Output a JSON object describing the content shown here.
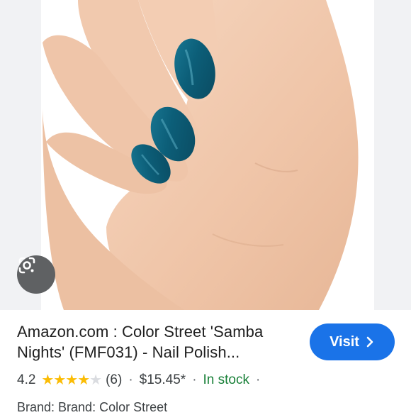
{
  "product": {
    "title_line1": "Amazon.com : Color Street 'Samba",
    "title_line2": "Nights' (FMF031) - Nail Polish...",
    "visit_label": "Visit",
    "rating": "4.2",
    "stars_filled": 4,
    "stars_total": 5,
    "reviews": "(6)",
    "price": "$15.45*",
    "stock": "In stock",
    "brand": "Brand: Brand: Color Street"
  },
  "icons": {
    "lens": "google-lens-icon",
    "visit": "chevron-right-icon",
    "star": "star-icon"
  },
  "colors": {
    "accent": "#1a73e8",
    "stock_green": "#188038",
    "star_gold": "#fbbc04",
    "nail_teal": "#0e6a87"
  }
}
